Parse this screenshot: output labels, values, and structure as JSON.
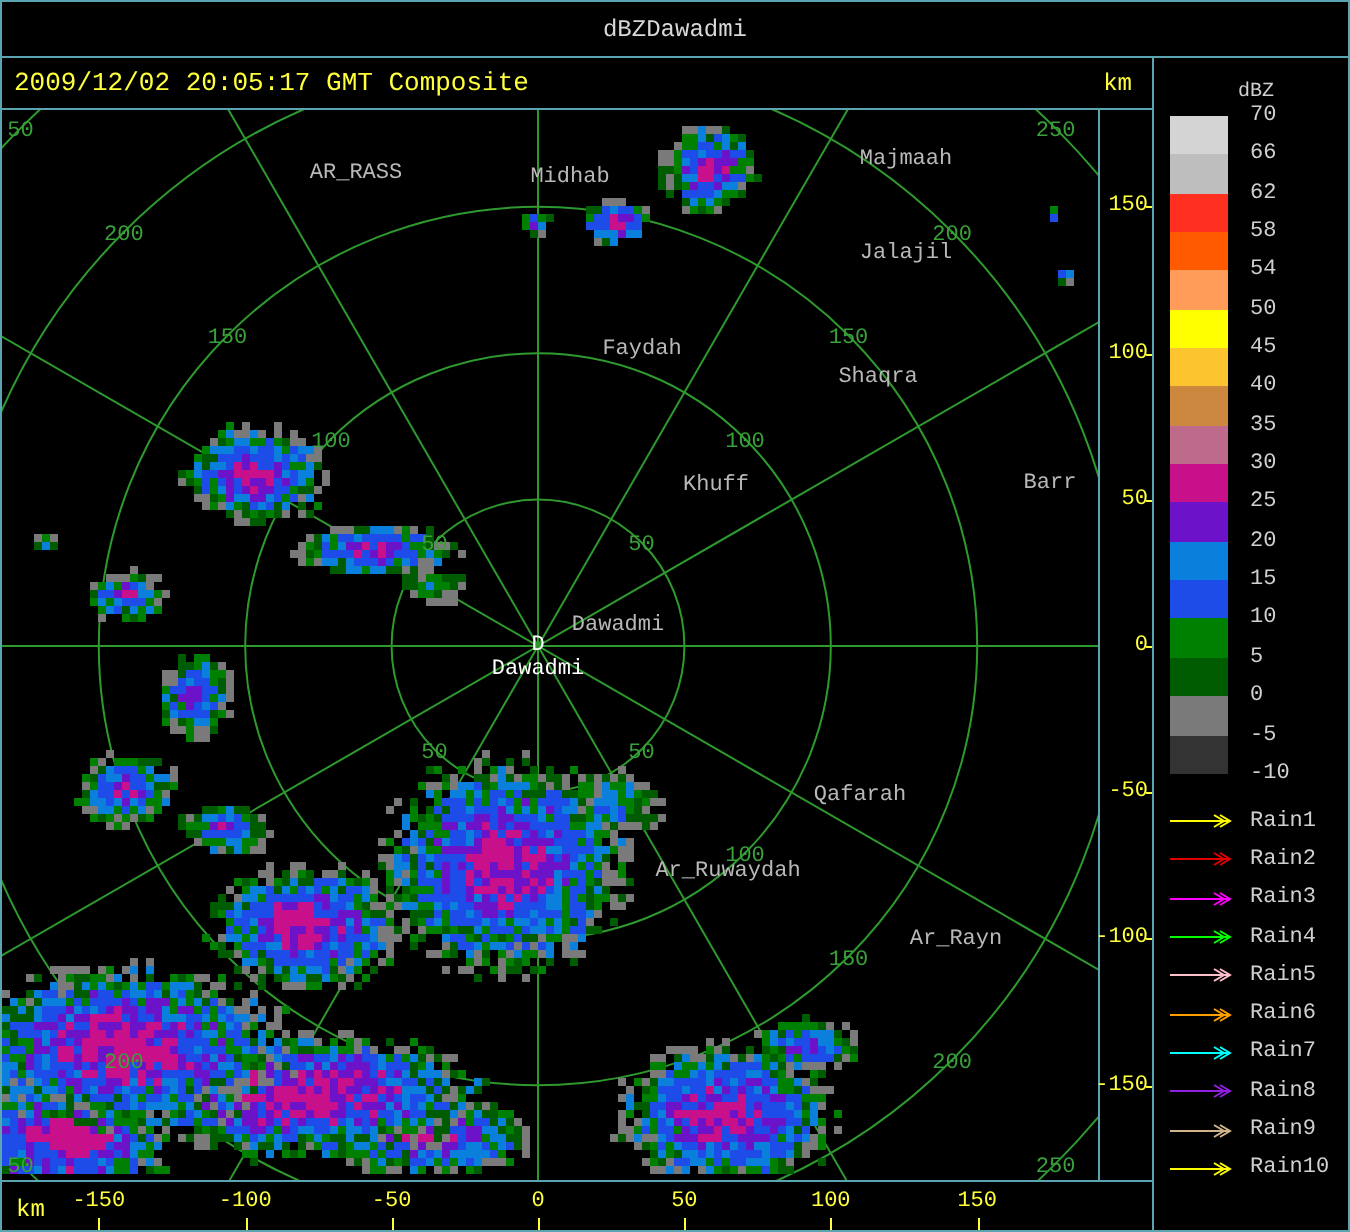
{
  "window": {
    "title": "dBZDawadmi"
  },
  "header": {
    "timestamp": "2009/12/02 20:05:17 GMT Composite",
    "unit": "km"
  },
  "map": {
    "places": [
      {
        "name": "AR_RASS"
      },
      {
        "name": "Midhab"
      },
      {
        "name": "Majmaah"
      },
      {
        "name": "Jalajil"
      },
      {
        "name": "Faydah"
      },
      {
        "name": "Shaqra"
      },
      {
        "name": "Khuff"
      },
      {
        "name": "Barr"
      },
      {
        "name": "Dawadmi"
      },
      {
        "name": "Qafarah"
      },
      {
        "name": "Ar_Ruwaydah"
      },
      {
        "name": "Ar_Rayn"
      }
    ],
    "site": {
      "marker": "D",
      "name": "Dawadmi"
    },
    "range_labels": [
      "50",
      "50",
      "50",
      "50",
      "100",
      "100",
      "100",
      "150",
      "150",
      "150",
      "200",
      "200",
      "200",
      "200",
      "50",
      "250",
      "50",
      "250"
    ]
  },
  "y_axis": {
    "ticks": [
      "150",
      "100",
      "50",
      "0",
      "-50",
      "-100",
      "-150"
    ]
  },
  "x_axis": {
    "unit": "km",
    "ticks": [
      "-150",
      "-100",
      "-50",
      "0",
      "50",
      "100",
      "150"
    ]
  },
  "legend": {
    "title": "dBZ",
    "swatches": [
      {
        "color": "#d4d4d4"
      },
      {
        "color": "#bebebe"
      },
      {
        "color": "#ff3020"
      },
      {
        "color": "#ff5a00"
      },
      {
        "color": "#ff9c5a"
      },
      {
        "color": "#ffff00"
      },
      {
        "color": "#fcc530"
      },
      {
        "color": "#cd883f"
      },
      {
        "color": "#be6a8a"
      },
      {
        "color": "#c8108a"
      },
      {
        "color": "#6c12c8"
      },
      {
        "color": "#0a80dc"
      },
      {
        "color": "#1e4ce8"
      },
      {
        "color": "#008000"
      },
      {
        "color": "#005c00"
      },
      {
        "color": "#7a7a7a"
      },
      {
        "color": "#333333"
      }
    ],
    "labels": [
      "70",
      "66",
      "62",
      "58",
      "54",
      "50",
      "45",
      "40",
      "35",
      "30",
      "25",
      "20",
      "15",
      "10",
      "5",
      "0",
      "-5",
      "-10"
    ],
    "rain_tracks": [
      {
        "label": "Rain1",
        "color": "#ffff00"
      },
      {
        "label": "Rain2",
        "color": "#e00000"
      },
      {
        "label": "Rain3",
        "color": "#ff00ff"
      },
      {
        "label": "Rain4",
        "color": "#00ff00"
      },
      {
        "label": "Rain5",
        "color": "#ffc0cb"
      },
      {
        "label": "Rain6",
        "color": "#ffa000"
      },
      {
        "label": "Rain7",
        "color": "#00ffff"
      },
      {
        "label": "Rain8",
        "color": "#9020e0"
      },
      {
        "label": "Rain9",
        "color": "#d2b48c"
      },
      {
        "label": "Rain10",
        "color": "#ffff00"
      }
    ]
  }
}
